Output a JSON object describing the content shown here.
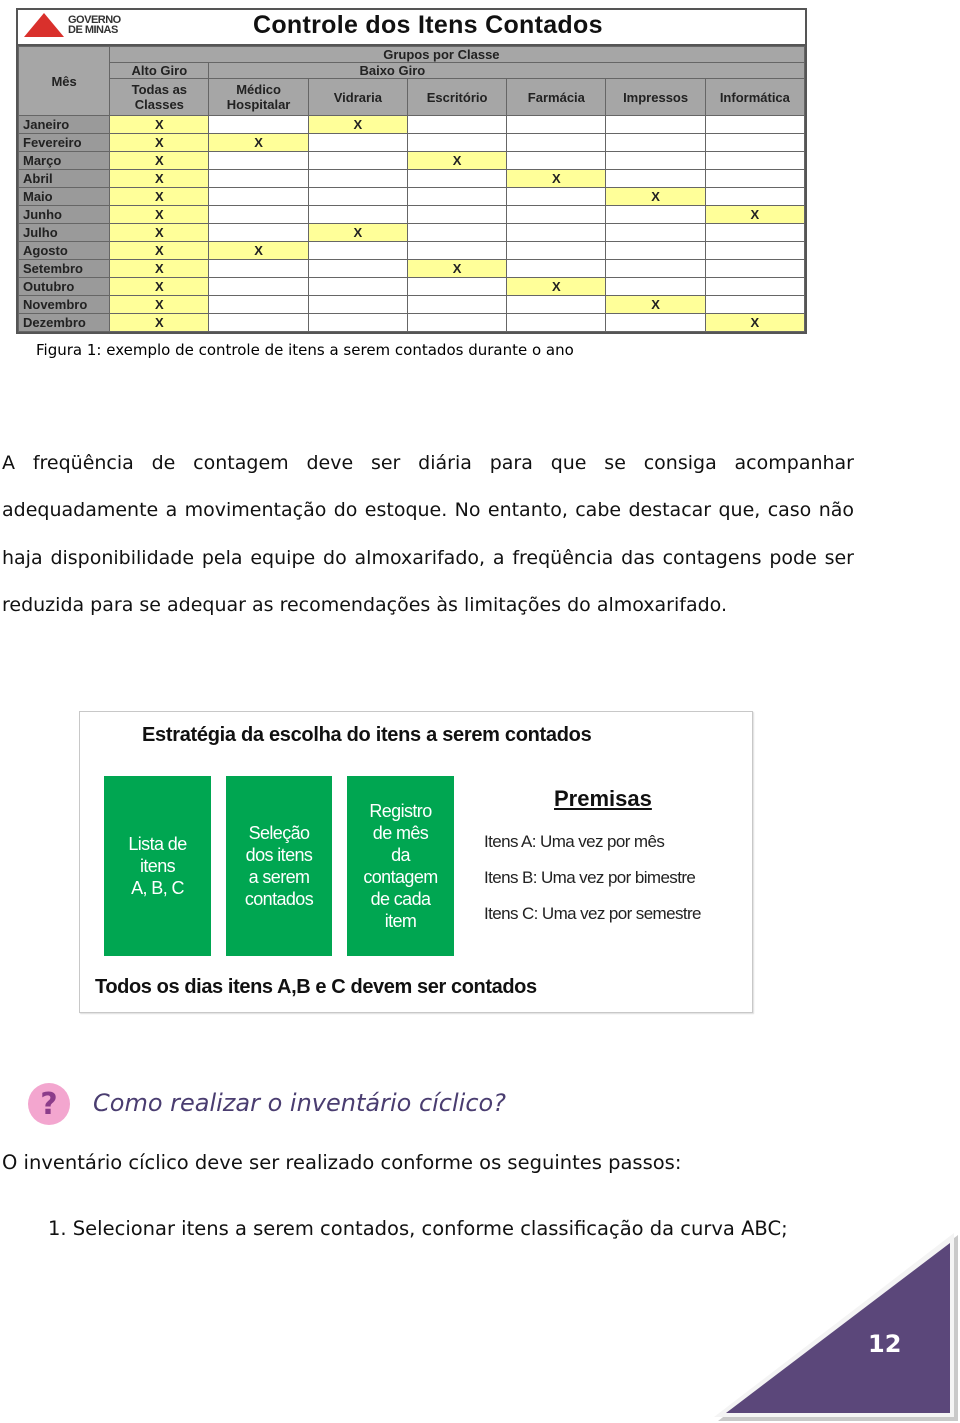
{
  "figure1": {
    "logo_line1": "GOVERNO",
    "logo_line2": "DE MINAS",
    "title": "Controle dos Itens Contados",
    "header_month": "Mês",
    "header_groups": "Grupos por Classe",
    "header_alto_giro": "Alto Giro",
    "header_baixo_giro": "Baixo Giro",
    "columns": [
      "Todas as Classes",
      "Médico Hospitalar",
      "Vidraria",
      "Escritório",
      "Farmácia",
      "Impressos",
      "Informática"
    ],
    "mark": "X",
    "rows": [
      {
        "month": "Janeiro",
        "marks": [
          1,
          0,
          1,
          0,
          0,
          0,
          0
        ]
      },
      {
        "month": "Fevereiro",
        "marks": [
          1,
          1,
          0,
          0,
          0,
          0,
          0
        ]
      },
      {
        "month": "Março",
        "marks": [
          1,
          0,
          0,
          1,
          0,
          0,
          0
        ]
      },
      {
        "month": "Abril",
        "marks": [
          1,
          0,
          0,
          0,
          1,
          0,
          0
        ]
      },
      {
        "month": "Maio",
        "marks": [
          1,
          0,
          0,
          0,
          0,
          1,
          0
        ]
      },
      {
        "month": "Junho",
        "marks": [
          1,
          0,
          0,
          0,
          0,
          0,
          1
        ]
      },
      {
        "month": "Julho",
        "marks": [
          1,
          0,
          1,
          0,
          0,
          0,
          0
        ]
      },
      {
        "month": "Agosto",
        "marks": [
          1,
          1,
          0,
          0,
          0,
          0,
          0
        ]
      },
      {
        "month": "Setembro",
        "marks": [
          1,
          0,
          0,
          1,
          0,
          0,
          0
        ]
      },
      {
        "month": "Outubro",
        "marks": [
          1,
          0,
          0,
          0,
          1,
          0,
          0
        ]
      },
      {
        "month": "Novembro",
        "marks": [
          1,
          0,
          0,
          0,
          0,
          1,
          0
        ]
      },
      {
        "month": "Dezembro",
        "marks": [
          1,
          0,
          0,
          0,
          0,
          0,
          1
        ]
      }
    ],
    "colors": {
      "header_gray": "#a6a6a6",
      "highlight_yellow": "#ffff99",
      "logo_red": "#d9302c"
    },
    "caption": "Figura 1: exemplo de controle de itens a serem contados durante o ano"
  },
  "paragraph": "A freqüência de contagem deve ser diária para que se consiga acompanhar adequadamente a movimentação do estoque. No entanto, cabe destacar que, caso não haja disponibilidade pela equipe do almoxarifado, a freqüência das contagens pode ser reduzida para se adequar as recomendações às limitações do almoxarifado.",
  "figure2": {
    "title": "Estratégia da escolha do itens a serem  contados",
    "boxes": [
      {
        "lines": [
          "Lista de",
          "itens",
          "A, B, C"
        ]
      },
      {
        "lines": [
          "Seleção",
          "dos itens",
          "a serem",
          "contados"
        ]
      },
      {
        "lines": [
          "Registro",
          "de mês",
          "da",
          "contagem",
          "de cada",
          "item"
        ]
      }
    ],
    "premisas_title": "Premisas",
    "premisas": [
      "Itens A:  Uma vez por mês",
      "Itens B:  Uma vez por bimestre",
      "Itens C:  Uma vez por semestre"
    ],
    "footer": "Todos os dias itens A,B e C devem  ser contados",
    "colors": {
      "box_green": "#00a651"
    }
  },
  "question": {
    "icon": "question-icon",
    "title": "Como realizar o inventário cíclico?"
  },
  "intro": "O inventário cíclico deve ser realizado conforme os seguintes passos:",
  "steps": [
    "1. Selecionar itens a serem contados, conforme classificação da curva ABC;"
  ],
  "page_number": "12",
  "page_badge_color": "#5b477a"
}
